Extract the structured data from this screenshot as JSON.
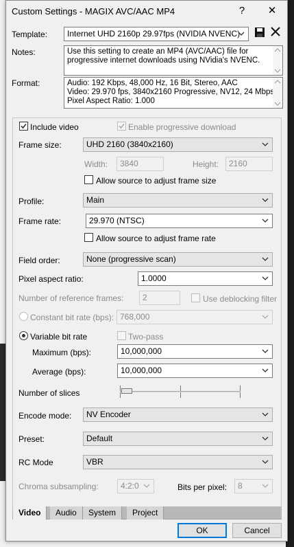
{
  "window": {
    "title": "Custom Settings - MAGIX AVC/AAC MP4",
    "help_glyph": "?",
    "close_glyph": "✕"
  },
  "template": {
    "label": "Template:",
    "value": "Internet UHD 2160p 29.97fps (NVIDIA NVENC)"
  },
  "notes": {
    "label": "Notes:",
    "text": "Use this setting to create an MP4 (AVC/AAC) file for progressive internet downloads using NVidia's NVENC."
  },
  "format": {
    "label": "Format:",
    "lines": [
      "Audio: 192 Kbps, 48,000 Hz, 16 Bit, Stereo, AAC",
      "Video: 29.970 fps, 3840x2160 Progressive, NV12, 24 Mbps",
      "Pixel Aspect Ratio: 1.000"
    ]
  },
  "video": {
    "include_video": "Include video",
    "progressive": "Enable progressive download",
    "frame_size_label": "Frame size:",
    "frame_size": "UHD 2160 (3840x2160)",
    "width_label": "Width:",
    "width": "3840",
    "height_label": "Height:",
    "height": "2160",
    "allow_frame_size": "Allow source to adjust frame size",
    "profile_label": "Profile:",
    "profile": "Main",
    "frame_rate_label": "Frame rate:",
    "frame_rate": "29.970 (NTSC)",
    "allow_frame_rate": "Allow source to adjust frame rate",
    "field_order_label": "Field order:",
    "field_order": "None (progressive scan)",
    "par_label": "Pixel aspect ratio:",
    "par": "1.0000",
    "ref_frames_label": "Number of reference frames:",
    "ref_frames": "2",
    "deblocking": "Use deblocking filter",
    "cbr_label": "Constant bit rate (bps):",
    "cbr": "768,000",
    "vbr_label": "Variable bit rate",
    "two_pass": "Two-pass",
    "max_label": "Maximum (bps):",
    "max": "10,000,000",
    "avg_label": "Average (bps):",
    "avg": "10,000,000",
    "slices_label": "Number of slices",
    "slices_level": 0,
    "encode_mode_label": "Encode mode:",
    "encode_mode": "NV Encoder",
    "preset_label": "Preset:",
    "preset": "Default",
    "rc_mode_label": "RC Mode",
    "rc_mode": "VBR",
    "chroma_label": "Chroma subsampling:",
    "chroma": "4:2:0",
    "bpp_label": "Bits per pixel:",
    "bpp": "8"
  },
  "tabs": [
    "Video",
    "Audio",
    "System",
    "Project"
  ],
  "buttons": {
    "ok": "OK",
    "cancel": "Cancel"
  },
  "colors": {
    "accent": "#0078d7",
    "check": "#333333"
  }
}
